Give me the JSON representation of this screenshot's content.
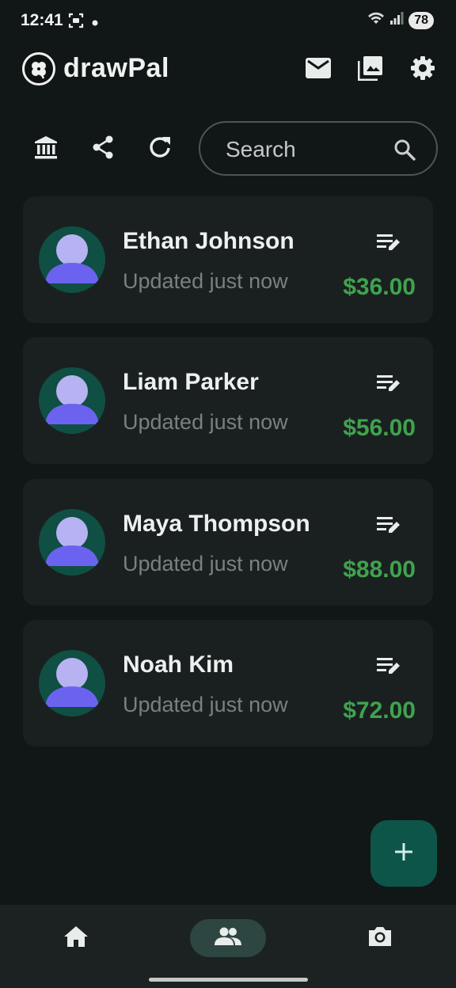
{
  "status_bar": {
    "time": "12:41",
    "battery": "78"
  },
  "app_bar": {
    "title": "drawPal",
    "actions": [
      "mail-icon",
      "gallery-icon",
      "settings-icon"
    ]
  },
  "toolbar": {
    "actions": [
      "bank-icon",
      "share-icon",
      "refresh-icon"
    ],
    "search_placeholder": "Search"
  },
  "friends": [
    {
      "name": "Ethan Johnson",
      "updated": "Updated just now",
      "amount": "$36.00"
    },
    {
      "name": "Liam Parker",
      "updated": "Updated just now",
      "amount": "$56.00"
    },
    {
      "name": "Maya Thompson",
      "updated": "Updated just now",
      "amount": "$88.00"
    },
    {
      "name": "Noah Kim",
      "updated": "Updated just now",
      "amount": "$72.00"
    }
  ],
  "fab": {
    "icon": "plus-icon"
  },
  "bottom_nav": {
    "items": [
      "home-icon",
      "people-icon",
      "camera-icon"
    ],
    "selected": "people-icon"
  },
  "colors": {
    "background": "#111716",
    "card": "#1a2020",
    "amount": "#3fa34d",
    "fab": "#0d5548",
    "avatar_bg": "#0f4f44",
    "avatar_figure": "#6b63f0"
  }
}
